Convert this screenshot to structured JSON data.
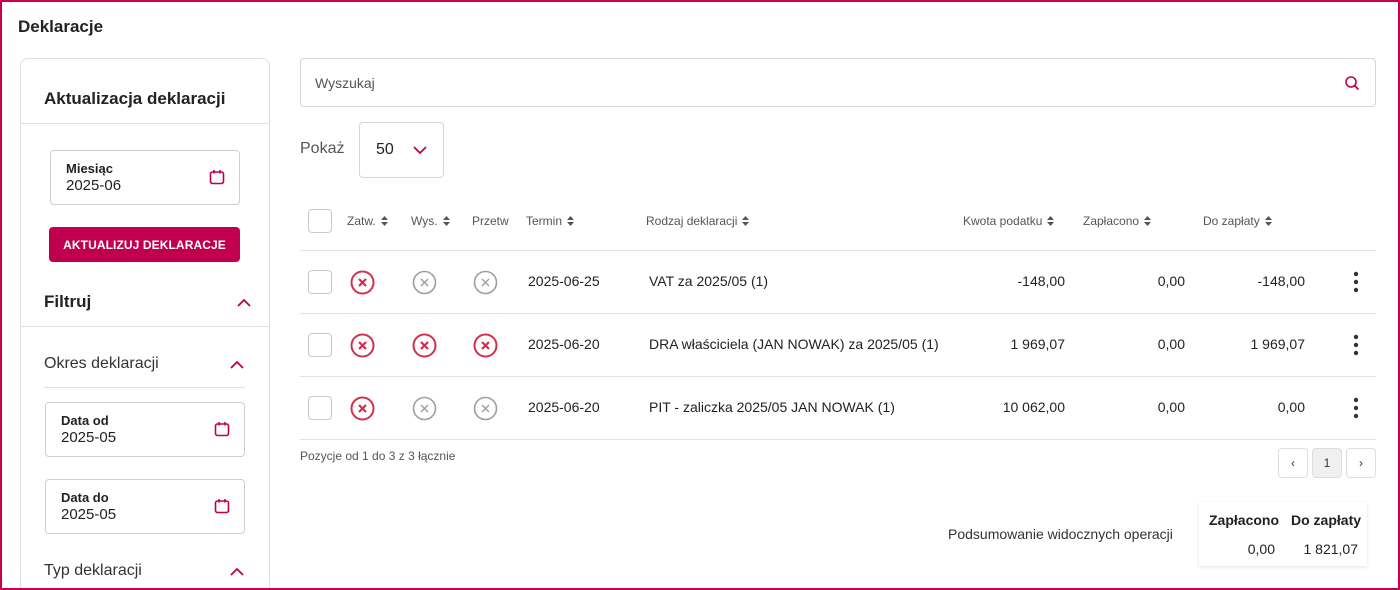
{
  "page": {
    "title": "Deklaracje"
  },
  "sidebar": {
    "panel_title": "Aktualizacja deklaracji",
    "month_field": {
      "label": "Miesiąc",
      "value": "2025-06",
      "icon": "calendar-icon"
    },
    "update_button": "AKTUALIZUJ DEKLARACJE",
    "filter_title": "Filtruj",
    "period_section": {
      "title": "Okres deklaracji",
      "date_from": {
        "label": "Data od",
        "value": "2025-05",
        "icon": "calendar-icon"
      },
      "date_to": {
        "label": "Data do",
        "value": "2025-05",
        "icon": "calendar-icon"
      }
    },
    "type_section": {
      "title": "Typ deklaracji"
    }
  },
  "search": {
    "placeholder": "Wyszukaj",
    "value": "",
    "icon": "search-icon"
  },
  "page_size": {
    "label": "Pokaż",
    "value": "50"
  },
  "table": {
    "columns": {
      "approved": "Zatw.",
      "sent": "Wys.",
      "processed": "Przetw",
      "due_date": "Termin",
      "type": "Rodzaj deklaracji",
      "tax_amount": "Kwota podatku",
      "paid": "Zapłacono",
      "to_pay": "Do zapłaty"
    },
    "rows": [
      {
        "status": {
          "approved": "error",
          "sent": "neutral",
          "processed": "neutral"
        },
        "due_date": "2025-06-25",
        "type": "VAT za 2025/05 (1)",
        "tax_amount": "-148,00",
        "paid": "0,00",
        "to_pay": "-148,00"
      },
      {
        "status": {
          "approved": "error",
          "sent": "error",
          "processed": "error"
        },
        "due_date": "2025-06-20",
        "type": "DRA właściciela (JAN NOWAK) za 2025/05 (1)",
        "tax_amount": "1 969,07",
        "paid": "0,00",
        "to_pay": "1 969,07"
      },
      {
        "status": {
          "approved": "error",
          "sent": "neutral",
          "processed": "neutral"
        },
        "due_date": "2025-06-20",
        "type": "PIT - zaliczka 2025/05 JAN NOWAK (1)",
        "tax_amount": "10 062,00",
        "paid": "0,00",
        "to_pay": "0,00"
      }
    ]
  },
  "pagination": {
    "info": "Pozycje od 1 do 3 z 3 łącznie",
    "prev": "‹",
    "current": "1",
    "next": "›"
  },
  "summary": {
    "label": "Podsumowanie widocznych operacji",
    "paid_header": "Zapłacono",
    "to_pay_header": "Do zapłaty",
    "paid_value": "0,00",
    "to_pay_value": "1 821,07"
  },
  "colors": {
    "accent": "#c0004f",
    "error": "#d32f4f",
    "neutral": "#9e9e9e",
    "frame": "#c8004f"
  }
}
